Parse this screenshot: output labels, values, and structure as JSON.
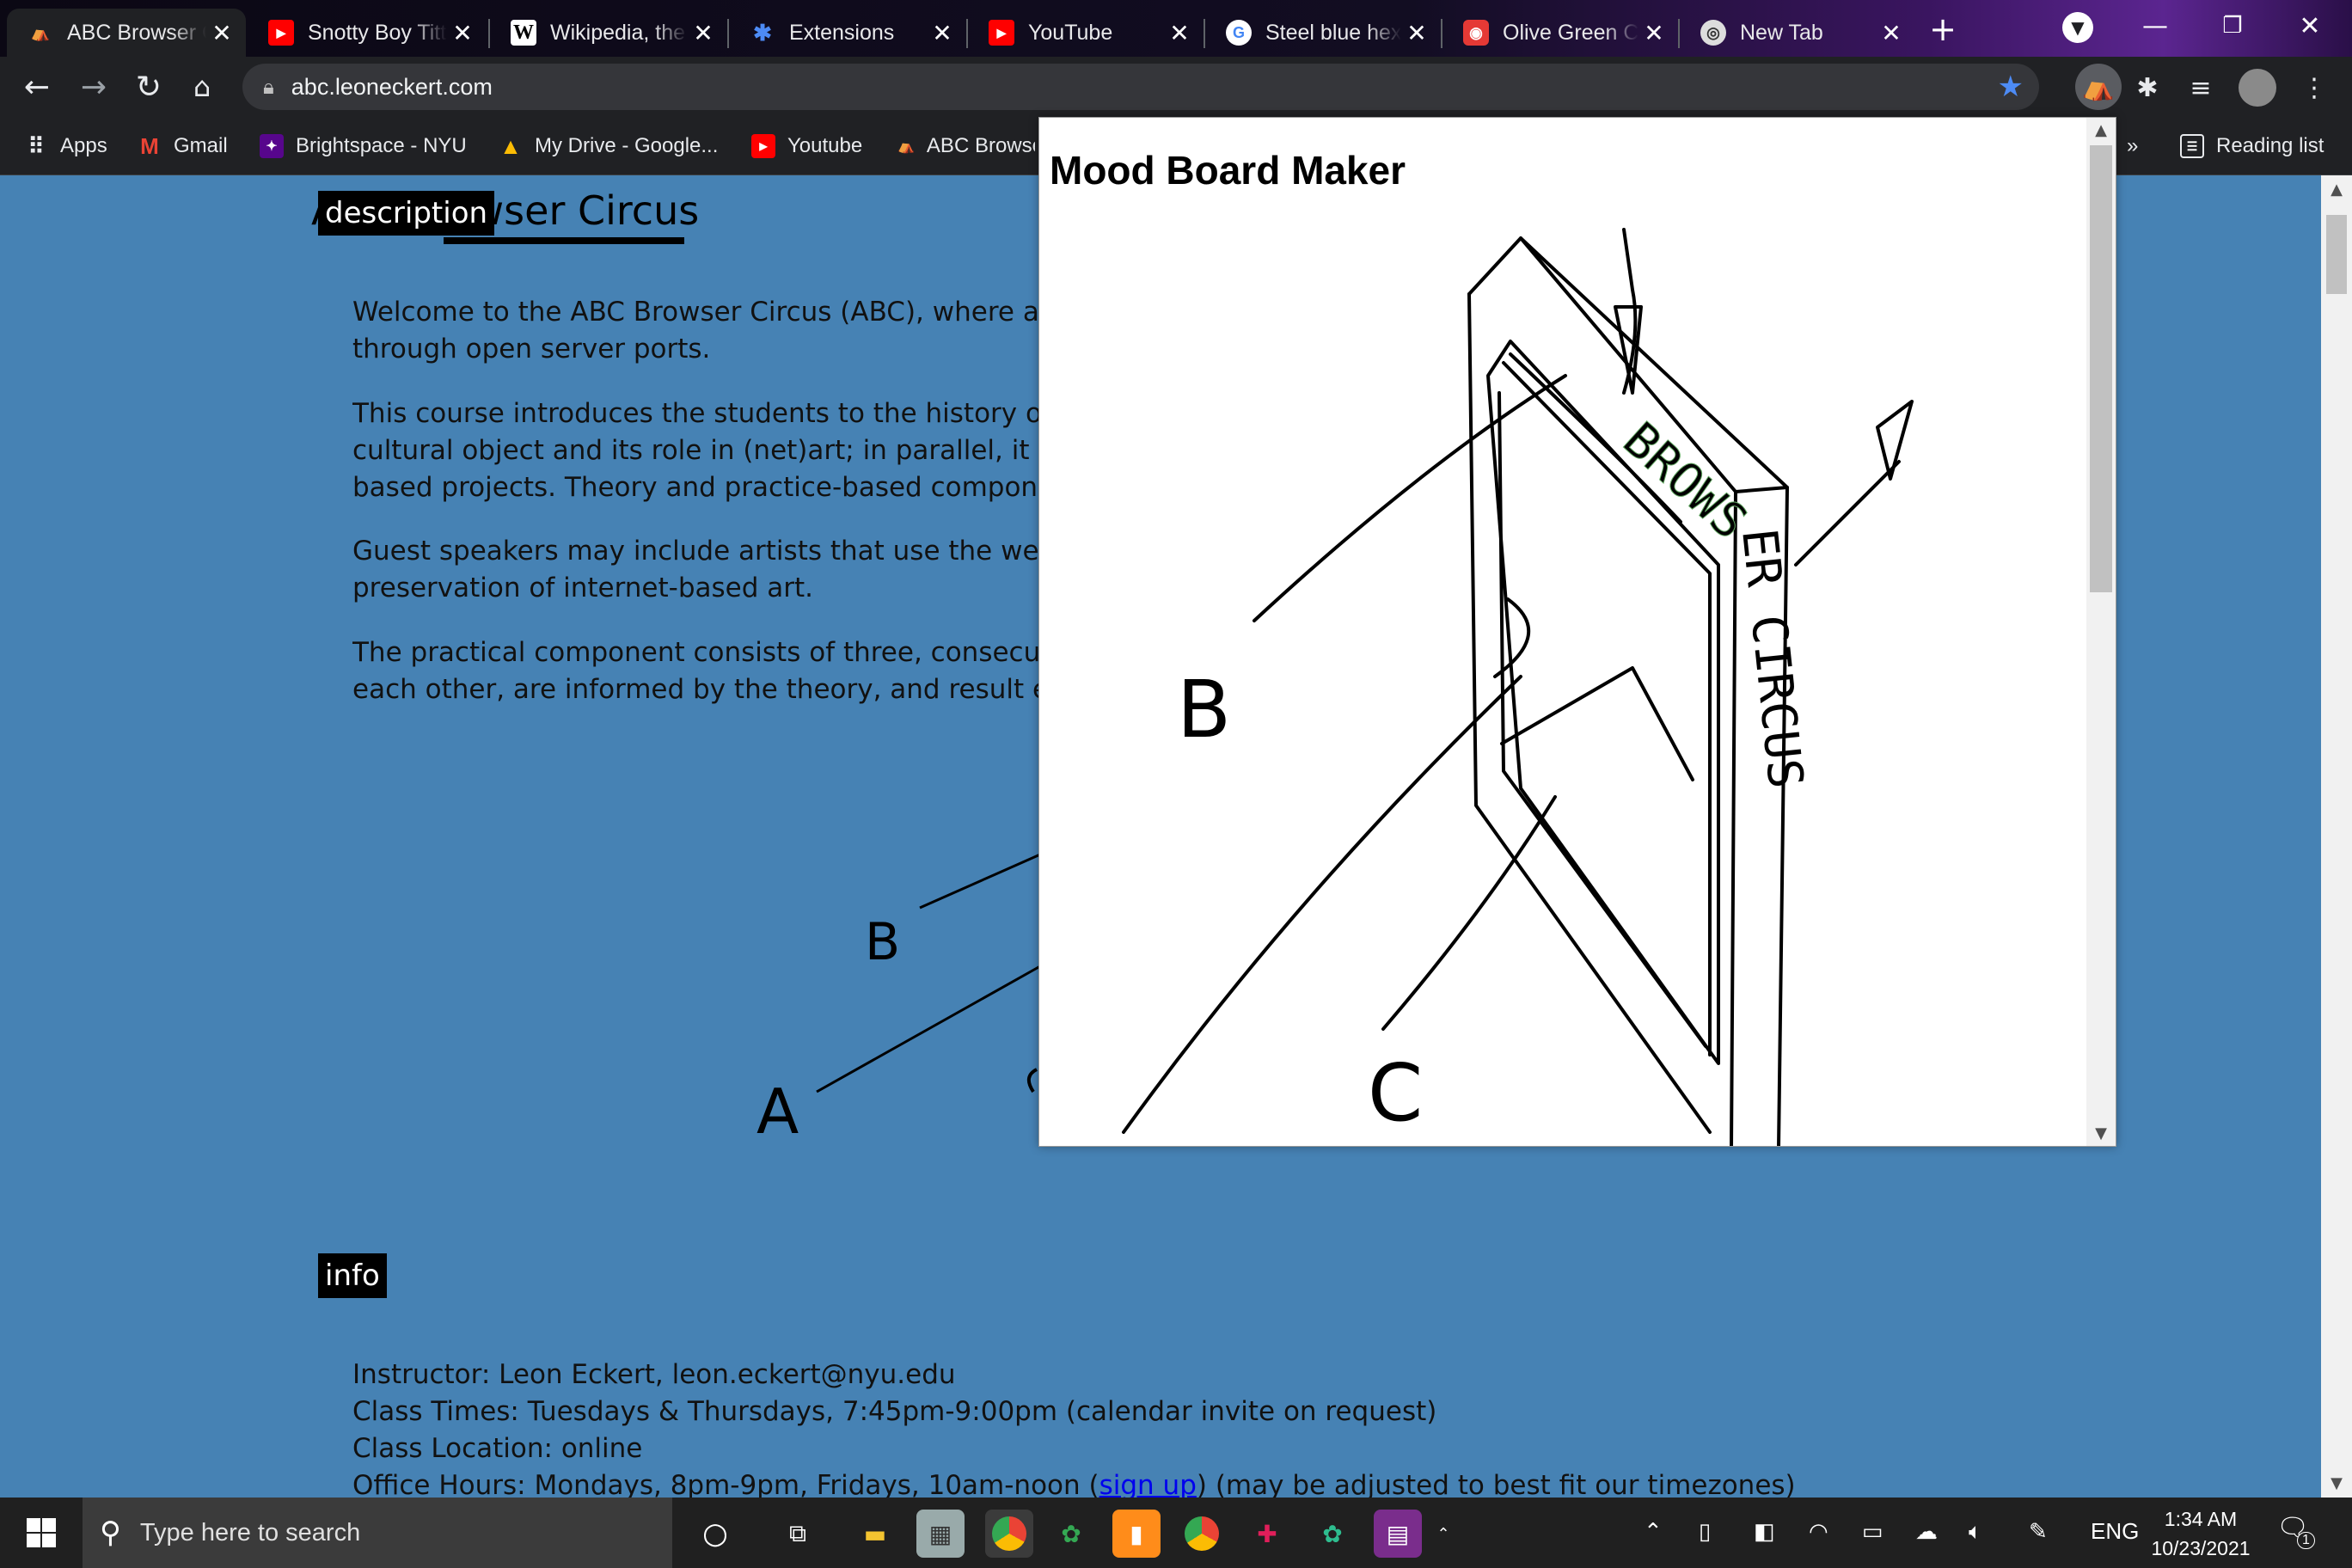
{
  "browser": {
    "tabs": [
      {
        "title": "ABC Browser Circus",
        "icon": "circus-tent-icon",
        "active": true
      },
      {
        "title": "Snotty Boy Titty Twister",
        "icon": "youtube-icon"
      },
      {
        "title": "Wikipedia, the free encyclopedia",
        "icon": "wikipedia-icon"
      },
      {
        "title": "Extensions",
        "icon": "puzzle-icon"
      },
      {
        "title": "YouTube",
        "icon": "youtube-icon"
      },
      {
        "title": "Steel blue hex color",
        "icon": "google-icon"
      },
      {
        "title": "Olive Green Color",
        "icon": "color-icon"
      },
      {
        "title": "New Tab",
        "icon": "chrome-icon"
      }
    ],
    "url": "abc.leoneckert.com",
    "bookmarks": [
      {
        "label": "Apps",
        "icon": "apps-grid-icon"
      },
      {
        "label": "Gmail",
        "icon": "gmail-icon"
      },
      {
        "label": "Brightspace - NYU",
        "icon": "brightspace-icon"
      },
      {
        "label": "My Drive - Google...",
        "icon": "google-drive-icon"
      },
      {
        "label": "Youtube",
        "icon": "youtube-icon"
      },
      {
        "label": "ABC Browser Circus",
        "icon": "circus-tent-icon"
      }
    ],
    "reading_list": "Reading list",
    "more_bookmarks": "»"
  },
  "page": {
    "description_label": "description",
    "title": "ABC Browser Circus",
    "paragraphs": [
      [
        "Welcome to the ABC Browser Circus (ABC), where acrobats perform",
        "through open server ports."
      ],
      [
        "This course introduces the students to the history of the web browser as a",
        "cultural object and its role in (net)art; in parallel, it teaches the creation of browser-",
        "based projects. Theory and practice-based components are equally weighted."
      ],
      [
        "Guest speakers may include artists that use the web as their medium and experts on the",
        "preservation of internet-based art."
      ],
      [
        "The practical component consists of three, consecutive projects that build on",
        "each other, are informed by the theory, and result each in a browser extension."
      ]
    ],
    "diagram_labels": {
      "a": "A",
      "b": "B",
      "c": "C"
    },
    "info_label": "info",
    "info_lines": {
      "instructor": "Instructor: Leon Eckert, leon.eckert@nyu.edu",
      "class_times": "Class Times: Tuesdays & Thursdays, 7:45pm-9:00pm (calendar invite on request)",
      "class_location": "Class Location: online",
      "office_hours_prefix": "Office Hours: Mondays, 8pm-9pm, Fridays, 10am-noon (",
      "office_hours_link": "sign up",
      "office_hours_suffix": ") (may be adjusted to best fit our timezones)"
    }
  },
  "popup": {
    "title": "Mood Board Maker",
    "drawing_text": {
      "frame": "BROWSER CIRCUS",
      "b": "B",
      "c": "C",
      "a": "A"
    }
  },
  "taskbar": {
    "search_placeholder": "Type here to search",
    "language": "ENG",
    "time": "1:34 AM",
    "date": "10/23/2021",
    "notification_count": "1"
  }
}
